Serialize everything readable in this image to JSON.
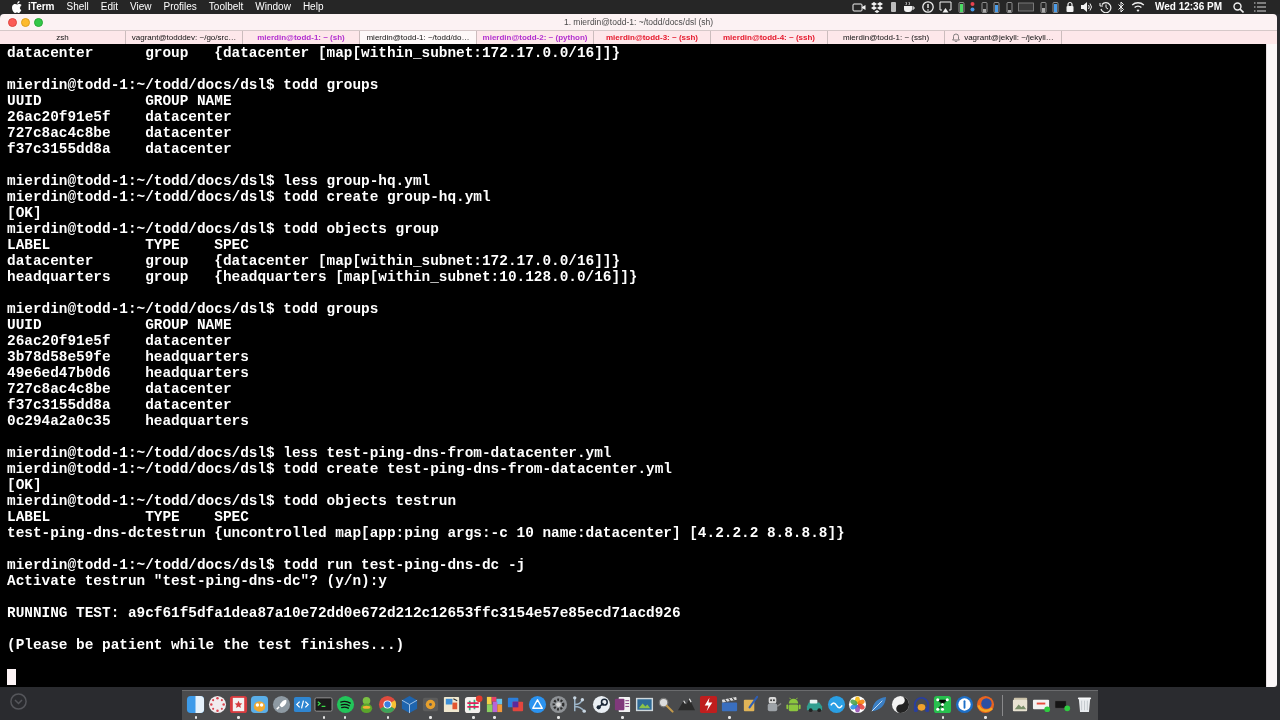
{
  "menubar": {
    "app_name": "iTerm",
    "menus": [
      "Shell",
      "Edit",
      "View",
      "Profiles",
      "Toolbelt",
      "Window",
      "Help"
    ],
    "clock": "Wed 12:36 PM"
  },
  "window": {
    "title": "1. mierdin@todd-1: ~/todd/docs/dsl (sh)"
  },
  "tabs": [
    {
      "label": "zsh",
      "selected": false,
      "bell": false
    },
    {
      "label": "vagrant@todddev: ~/go/src…",
      "selected": false,
      "bell": false
    },
    {
      "label": "mierdin@todd-1: ~ (sh)",
      "selected": false,
      "color": "#b22fd0",
      "bell": false
    },
    {
      "label": "mierdin@todd-1: ~/todd/do…",
      "selected": true,
      "bell": false
    },
    {
      "label": "mierdin@todd-2: ~ (python)",
      "selected": false,
      "color": "#b22fd0",
      "bell": false
    },
    {
      "label": "mierdin@todd-3: ~ (ssh)",
      "selected": false,
      "color": "#e5182c",
      "bell": false
    },
    {
      "label": "mierdin@todd-4: ~ (ssh)",
      "selected": false,
      "color": "#e5182c",
      "bell": false
    },
    {
      "label": "mierdin@todd-1: ~ (ssh)",
      "selected": false,
      "bell": false
    },
    {
      "label": "vagrant@jekyll: ~/jekyll…",
      "selected": false,
      "bell": true
    }
  ],
  "terminal": {
    "blocks": [
      [
        "datacenter      group   {datacenter [map[within_subnet:172.17.0.0/16]]}"
      ],
      [
        "mierdin@todd-1:~/todd/docs/dsl$ todd groups",
        "UUID            GROUP NAME",
        "26ac20f91e5f    datacenter",
        "727c8ac4c8be    datacenter",
        "f37c3155dd8a    datacenter"
      ],
      [
        "mierdin@todd-1:~/todd/docs/dsl$ less group-hq.yml",
        "mierdin@todd-1:~/todd/docs/dsl$ todd create group-hq.yml",
        "[OK]",
        "mierdin@todd-1:~/todd/docs/dsl$ todd objects group",
        "LABEL           TYPE    SPEC",
        "datacenter      group   {datacenter [map[within_subnet:172.17.0.0/16]]}",
        "headquarters    group   {headquarters [map[within_subnet:10.128.0.0/16]]}"
      ],
      [
        "mierdin@todd-1:~/todd/docs/dsl$ todd groups",
        "UUID            GROUP NAME",
        "26ac20f91e5f    datacenter",
        "3b78d58e59fe    headquarters",
        "49e6ed47b0d6    headquarters",
        "727c8ac4c8be    datacenter",
        "f37c3155dd8a    datacenter",
        "0c294a2a0c35    headquarters"
      ],
      [
        "mierdin@todd-1:~/todd/docs/dsl$ less test-ping-dns-from-datacenter.yml",
        "mierdin@todd-1:~/todd/docs/dsl$ todd create test-ping-dns-from-datacenter.yml",
        "[OK]",
        "mierdin@todd-1:~/todd/docs/dsl$ todd objects testrun",
        "LABEL           TYPE    SPEC",
        "test-ping-dns-dctestrun {uncontrolled map[app:ping args:-c 10 name:datacenter] [4.2.2.2 8.8.8.8]}"
      ],
      [
        "mierdin@todd-1:~/todd/docs/dsl$ todd run test-ping-dns-dc -j",
        "Activate testrun \"test-ping-dns-dc\"? (y/n):y"
      ],
      [
        "RUNNING TEST: a9cf61f5dfa1dea87a10e72dd0e672d212c12653ffc3154e57e85ecd71acd926"
      ],
      [
        "(Please be patient while the test finishes...)"
      ]
    ],
    "cursor": true
  },
  "dock": {
    "items": [
      {
        "running": true
      },
      {
        "running": false
      },
      {
        "running": true
      },
      {
        "running": false
      },
      {
        "running": false
      },
      {
        "running": false
      },
      {
        "running": true
      },
      {
        "running": true
      },
      {
        "running": false
      },
      {
        "running": true
      },
      {
        "running": false
      },
      {
        "running": true
      },
      {
        "running": false
      },
      {
        "running": true
      },
      {
        "running": true
      },
      {
        "running": false
      },
      {
        "running": false
      },
      {
        "running": true
      },
      {
        "running": false
      },
      {
        "running": false
      },
      {
        "running": true
      },
      {
        "running": false
      },
      {
        "running": false
      },
      {
        "running": false
      },
      {
        "running": false
      },
      {
        "running": true
      },
      {
        "running": false
      },
      {
        "running": false
      },
      {
        "running": false
      },
      {
        "running": false
      },
      {
        "running": false
      },
      {
        "running": false
      },
      {
        "running": false
      },
      {
        "running": false
      },
      {
        "running": false
      },
      {
        "running": true
      },
      {
        "running": false
      },
      {
        "running": true
      },
      {
        "running": false
      },
      {
        "running": false
      },
      {
        "running": false
      },
      {
        "running": false
      }
    ]
  }
}
